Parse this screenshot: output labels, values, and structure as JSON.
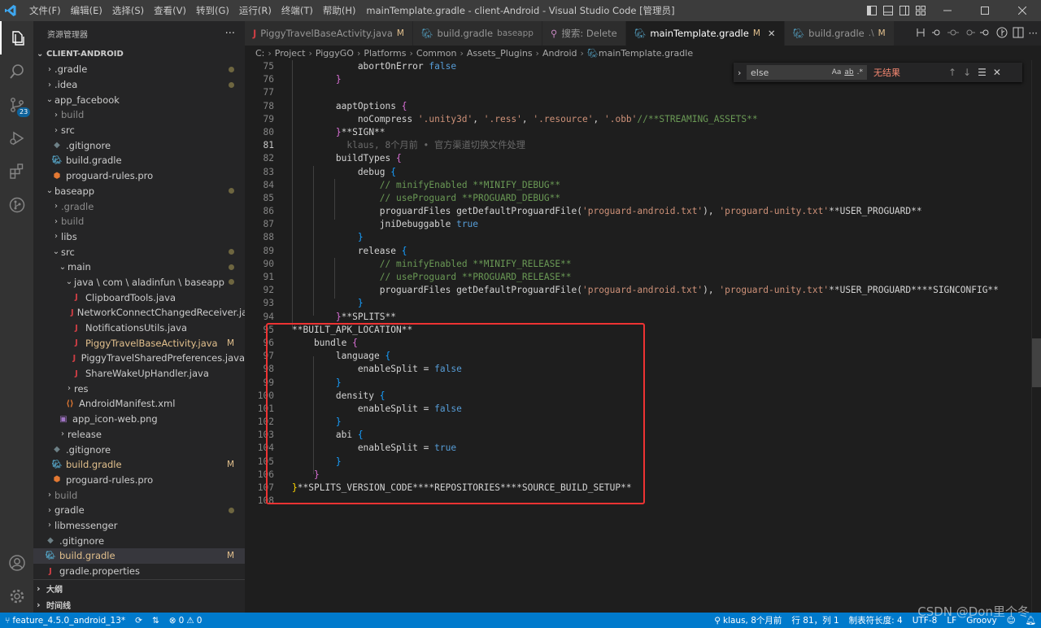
{
  "window": {
    "title": "mainTemplate.gradle - client-Android - Visual Studio Code [管理员]"
  },
  "menu": [
    "文件(F)",
    "编辑(E)",
    "选择(S)",
    "查看(V)",
    "转到(G)",
    "运行(R)",
    "终端(T)",
    "帮助(H)"
  ],
  "activity": {
    "scm_badge": "23"
  },
  "sidebar": {
    "title": "资源管理器",
    "more": "···",
    "root": "CLIENT-ANDROID",
    "items": [
      {
        "label": ".gradle",
        "indent": 1,
        "chev": "›",
        "dot": true
      },
      {
        "label": ".idea",
        "indent": 1,
        "chev": "›",
        "dot": true
      },
      {
        "label": "app_facebook",
        "indent": 1,
        "chev": "⌄"
      },
      {
        "label": "build",
        "indent": 2,
        "chev": "›",
        "dim": true
      },
      {
        "label": "src",
        "indent": 2,
        "chev": "›"
      },
      {
        "label": ".gitignore",
        "indent": 2,
        "icon": "git"
      },
      {
        "label": "build.gradle",
        "indent": 2,
        "icon": "gradle"
      },
      {
        "label": "proguard-rules.pro",
        "indent": 2,
        "icon": "pro"
      },
      {
        "label": "baseapp",
        "indent": 1,
        "chev": "⌄",
        "dot": true
      },
      {
        "label": ".gradle",
        "indent": 2,
        "chev": "›",
        "dim": true
      },
      {
        "label": "build",
        "indent": 2,
        "chev": "›",
        "dim": true
      },
      {
        "label": "libs",
        "indent": 2,
        "chev": "›"
      },
      {
        "label": "src",
        "indent": 2,
        "chev": "⌄",
        "dot": true
      },
      {
        "label": "main",
        "indent": 3,
        "chev": "⌄",
        "dot": true
      },
      {
        "label": "java \\ com \\ aladinfun \\ baseapp",
        "indent": 4,
        "chev": "⌄",
        "dot": true
      },
      {
        "label": "ClipboardTools.java",
        "indent": 5,
        "icon": "java"
      },
      {
        "label": "NetworkConnectChangedReceiver.java",
        "indent": 5,
        "icon": "java"
      },
      {
        "label": "NotificationsUtils.java",
        "indent": 5,
        "icon": "java"
      },
      {
        "label": "PiggyTravelBaseActivity.java",
        "indent": 5,
        "icon": "java",
        "mod": "M"
      },
      {
        "label": "PiggyTravelSharedPreferences.java",
        "indent": 5,
        "icon": "java"
      },
      {
        "label": "ShareWakeUpHandler.java",
        "indent": 5,
        "icon": "java"
      },
      {
        "label": "res",
        "indent": 4,
        "chev": "›"
      },
      {
        "label": "AndroidManifest.xml",
        "indent": 4,
        "icon": "xml"
      },
      {
        "label": "app_icon-web.png",
        "indent": 3,
        "icon": "png"
      },
      {
        "label": "release",
        "indent": 3,
        "chev": "›"
      },
      {
        "label": ".gitignore",
        "indent": 2,
        "icon": "git"
      },
      {
        "label": "build.gradle",
        "indent": 2,
        "icon": "gradle",
        "mod": "M"
      },
      {
        "label": "proguard-rules.pro",
        "indent": 2,
        "icon": "pro"
      },
      {
        "label": "build",
        "indent": 1,
        "chev": "›",
        "dim": true
      },
      {
        "label": "gradle",
        "indent": 1,
        "chev": "›",
        "dot": true
      },
      {
        "label": "libmessenger",
        "indent": 1,
        "chev": "›"
      },
      {
        "label": ".gitignore",
        "indent": 1,
        "icon": "git"
      },
      {
        "label": "build.gradle",
        "indent": 1,
        "icon": "gradle",
        "mod": "M",
        "sel": true
      },
      {
        "label": "gradle.properties",
        "indent": 1,
        "icon": "props"
      }
    ],
    "outline": "大纲",
    "timeline": "时间线"
  },
  "tabs": [
    {
      "label": "PiggyTravelBaseActivity.java",
      "mod": "M",
      "icon": "java"
    },
    {
      "label": "build.gradle",
      "desc": "baseapp",
      "icon": "gradle"
    },
    {
      "label": "搜索: Delete",
      "icon": "search"
    },
    {
      "label": "mainTemplate.gradle",
      "mod": "M",
      "icon": "gradle",
      "active": true
    },
    {
      "label": "build.gradle",
      "desc": ".\\",
      "mod": "M",
      "icon": "gradle"
    }
  ],
  "breadcrumb": [
    "C:",
    "Project",
    "PiggyGO",
    "Platforms",
    "Common",
    "Assets_Plugins",
    "Android",
    "mainTemplate.gradle"
  ],
  "find": {
    "query": "else",
    "result": "无结果",
    "opts": [
      "Aa",
      "ab",
      ".*"
    ]
  },
  "code": [
    {
      "n": "75",
      "html": "            abortOnError <span class='k'>false</span>"
    },
    {
      "n": "76",
      "html": "        <span class='p'>}</span>"
    },
    {
      "n": "77",
      "html": ""
    },
    {
      "n": "78",
      "html": "        aaptOptions <span class='p'>{</span>"
    },
    {
      "n": "79",
      "html": "            noCompress <span class='s'>'.unity3d'</span>, <span class='s'>'.ress'</span>, <span class='s'>'.resource'</span>, <span class='s'>'.obb'</span><span class='c'>//**STREAMING_ASSETS**</span>"
    },
    {
      "n": "80",
      "html": "        <span class='p'>}</span>**SIGN**"
    },
    {
      "n": "81",
      "html": "          <span class='blame'>klaus, 8个月前 • 官方渠道切换文件处理</span>",
      "cur": true
    },
    {
      "n": "82",
      "html": "        buildTypes <span class='p'>{</span>"
    },
    {
      "n": "83",
      "html": "            debug <span class='b'>{</span>"
    },
    {
      "n": "84",
      "html": "                <span class='c'>// minifyEnabled **MINIFY_DEBUG**</span>"
    },
    {
      "n": "85",
      "html": "                <span class='c'>// useProguard **PROGUARD_DEBUG**</span>"
    },
    {
      "n": "86",
      "html": "                proguardFiles getDefaultProguardFile(<span class='s'>'proguard-android.txt'</span>), <span class='s'>'proguard-unity.txt'</span>**USER_PROGUARD**"
    },
    {
      "n": "87",
      "html": "                jniDebuggable <span class='k'>true</span>"
    },
    {
      "n": "88",
      "html": "            <span class='b'>}</span>"
    },
    {
      "n": "89",
      "html": "            release <span class='b'>{</span>"
    },
    {
      "n": "90",
      "html": "                <span class='c'>// minifyEnabled **MINIFY_RELEASE**</span>"
    },
    {
      "n": "91",
      "html": "                <span class='c'>// useProguard **PROGUARD_RELEASE**</span>"
    },
    {
      "n": "92",
      "html": "                proguardFiles getDefaultProguardFile(<span class='s'>'proguard-android.txt'</span>), <span class='s'>'proguard-unity.txt'</span>**USER_PROGUARD****SIGNCONFIG**"
    },
    {
      "n": "93",
      "html": "            <span class='b'>}</span>"
    },
    {
      "n": "94",
      "html": "        <span class='p'>}</span>**SPLITS**"
    },
    {
      "n": "95",
      "html": "**BUILT_APK_LOCATION**"
    },
    {
      "n": "96",
      "html": "    bundle <span class='p'>{</span>"
    },
    {
      "n": "97",
      "html": "        language <span class='b'>{</span>"
    },
    {
      "n": "98",
      "html": "            enableSplit = <span class='k'>false</span>"
    },
    {
      "n": "99",
      "html": "        <span class='b'>}</span>"
    },
    {
      "n": "100",
      "html": "        density <span class='b'>{</span>"
    },
    {
      "n": "101",
      "html": "            enableSplit = <span class='k'>false</span>"
    },
    {
      "n": "102",
      "html": "        <span class='b'>}</span>"
    },
    {
      "n": "103",
      "html": "        abi <span class='b'>{</span>"
    },
    {
      "n": "104",
      "html": "            enableSplit = <span class='k'>true</span>"
    },
    {
      "n": "105",
      "html": "        <span class='b'>}</span>"
    },
    {
      "n": "106",
      "html": "    <span class='p'>}</span>"
    },
    {
      "n": "107",
      "html": "<span class='y'>}</span>**SPLITS_VERSION_CODE****REPOSITORIES****SOURCE_BUILD_SETUP**"
    },
    {
      "n": "108",
      "html": ""
    }
  ],
  "status": {
    "branch": "feature_4.5.0_android_13*",
    "errors": "0",
    "warnings": "0",
    "blame": "klaus, 8个月前",
    "position": "行 81，列 1",
    "tabsize": "制表符长度: 4",
    "encoding": "UTF-8",
    "eol": "LF",
    "lang": "Groovy"
  },
  "watermark": "CSDN @Don里个冬"
}
